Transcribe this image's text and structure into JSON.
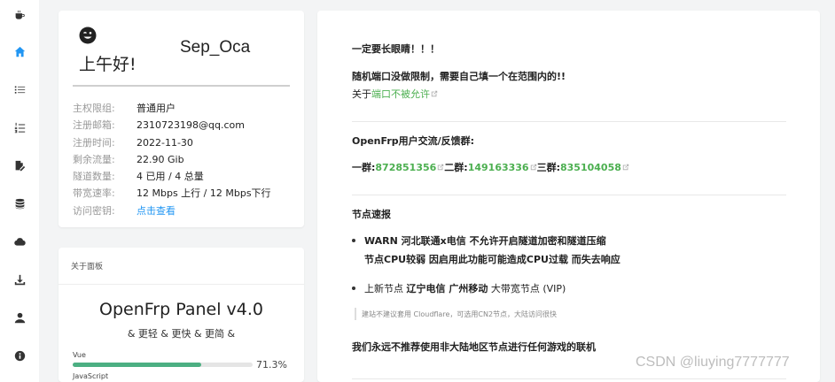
{
  "sidebar": {
    "items": [
      {
        "icon": "coffee-icon"
      },
      {
        "icon": "home-icon",
        "active": true
      },
      {
        "icon": "list-icon"
      },
      {
        "icon": "ordered-list-icon"
      },
      {
        "icon": "file-edit-icon"
      },
      {
        "icon": "database-icon"
      },
      {
        "icon": "cloud-icon"
      },
      {
        "icon": "download-icon"
      },
      {
        "icon": "user-icon"
      },
      {
        "icon": "info-icon"
      }
    ],
    "active_color": "#2196f3"
  },
  "user_card": {
    "greeting": "上午好!",
    "username": "Sep_Oca",
    "rows": [
      {
        "label": "主权限组:",
        "value": "普通用户"
      },
      {
        "label": "注册邮箱:",
        "value": "2310723198@qq.com"
      },
      {
        "label": "注册时间:",
        "value": "2022-11-30"
      },
      {
        "label": "剩余流量:",
        "value": "22.90 Gib"
      },
      {
        "label": "隧道数量:",
        "value": "4 已用 / 4 总量"
      },
      {
        "label": "带宽速率:",
        "value": "12 Mbps 上行 / 12 Mbps下行"
      },
      {
        "label": "访问密钥:",
        "value": "点击查看"
      }
    ]
  },
  "about_card": {
    "title": "关于面板",
    "panel_name": "OpenFrp Panel v4.0",
    "slogan": "& 更轻 & 更快 & 更简 &",
    "techs": [
      {
        "name": "Vue",
        "percent": "71.3%",
        "fraction": 0.713
      },
      {
        "name": "JavaScript"
      }
    ],
    "bar_color": "#4caf82"
  },
  "notice": {
    "warn_title": "一定要长眼睛！！！",
    "port_notice": "随机端口没做限制，需要自己填一个在范围内的!!",
    "about_prefix": "关于",
    "port_link": "端口不被允许",
    "group_title": "OpenFrp用户交流/反馈群:",
    "groups": [
      {
        "label": "一群:",
        "number": "872851356"
      },
      {
        "label": "二群:",
        "number": "149163336"
      },
      {
        "label": "三群:",
        "number": "835104058"
      }
    ],
    "speed_title": "节点速报",
    "warn_line1": "WARN 河北联通x电信 不允许开启隧道加密和隧道压缩",
    "warn_line2": "节点CPU较弱 因启用此功能可能造成CPU过载 而失去响应",
    "new_node_prefix": "上新节点 ",
    "new_node_bold": "辽宁电信 广州移动",
    "new_node_suffix": " 大带宽节点 (VIP)",
    "quote": "建站不建议套用 Cloudflare，可选用CN2节点，大陆访问很快",
    "final": "我们永远不推荐使用非大陆地区节点进行任何游戏的联机",
    "link_color": "#4caf50"
  },
  "watermark": "CSDN @liuying7777777"
}
